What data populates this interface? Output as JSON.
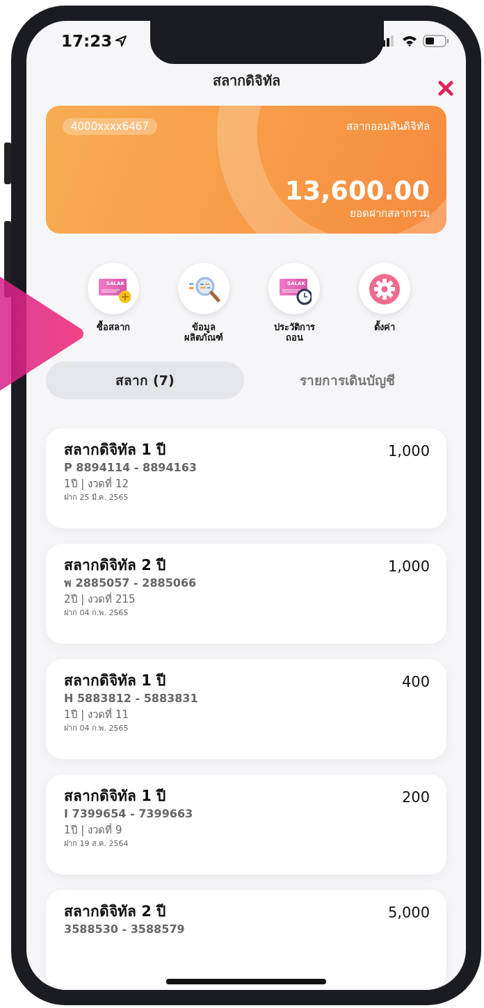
{
  "status_bar": {
    "time": "17:23"
  },
  "header": {
    "title": "สลากดิจิทัล"
  },
  "account_card": {
    "account_number": "4000xxxx6467",
    "product": "สลากออมสินดิจิทัล",
    "balance": "13,600.00",
    "balance_label": "ยอดฝากสลากรวม"
  },
  "shortcuts": [
    {
      "kind": "buy",
      "label": "ซื้อสลาก",
      "icon_text": "SALAK"
    },
    {
      "kind": "info",
      "label": "ข้อมูล\nผลิตภัณฑ์"
    },
    {
      "kind": "history",
      "label": "ประวัติการ\nถอน",
      "icon_text": "SALAK"
    },
    {
      "kind": "settings",
      "label": "ตั้งค่า"
    }
  ],
  "tabs": [
    {
      "label": "สลาก (7)",
      "selected": true
    },
    {
      "label": "รายการเดินบัญชี",
      "selected": false
    }
  ],
  "items": [
    {
      "name": "สลากดิจิทัล 1 ปี",
      "amount": "1,000",
      "serial": "P 8894114 - 8894163",
      "term": "1ปี | งวดที่ 12",
      "deposit_date": "ฝาก 25 มี.ค. 2565"
    },
    {
      "name": "สลากดิจิทัล 2 ปี",
      "amount": "1,000",
      "serial": "พ 2885057 - 2885066",
      "term": "2ปี | งวดที่ 215",
      "deposit_date": "ฝาก 04 ก.พ. 2565"
    },
    {
      "name": "สลากดิจิทัล 1 ปี",
      "amount": "400",
      "serial": "H 5883812 - 5883831",
      "term": "1ปี | งวดที่ 11",
      "deposit_date": "ฝาก 04 ก.พ. 2565"
    },
    {
      "name": "สลากดิจิทัล 1 ปี",
      "amount": "200",
      "serial": "I 7399654 - 7399663",
      "term": "1ปี | งวดที่ 9",
      "deposit_date": "ฝาก 19 ส.ค. 2564"
    },
    {
      "name": "สลากดิจิทัล 2 ปี",
      "amount": "5,000",
      "serial": "3588530 - 3588579"
    }
  ]
}
